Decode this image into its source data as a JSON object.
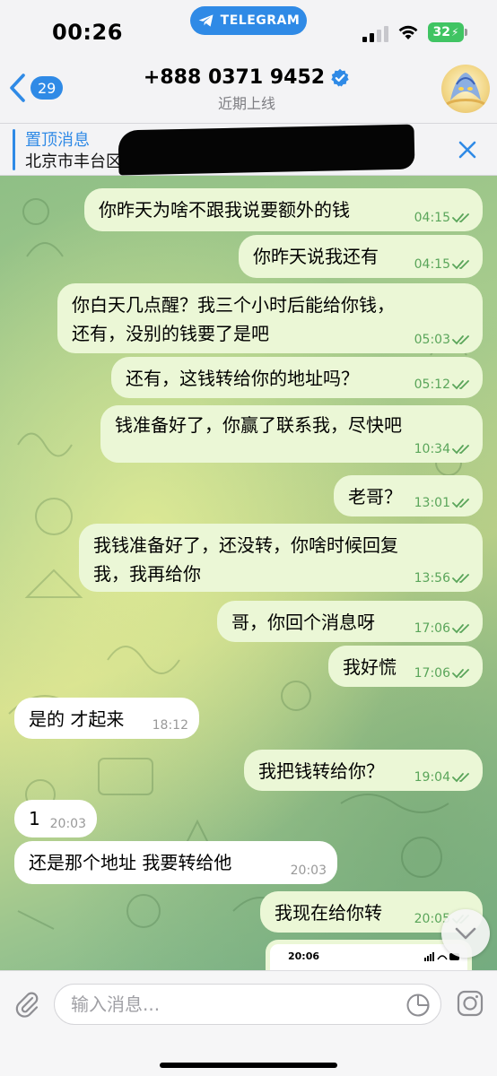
{
  "status_bar": {
    "time": "00:26",
    "app_pill": "TELEGRAM",
    "battery": "32"
  },
  "header": {
    "back_count": "29",
    "title": "+888 0371 9452",
    "subtitle": "近期上线"
  },
  "pinned": {
    "label": "置顶消息",
    "text": "北京市丰台区"
  },
  "messages": [
    {
      "dir": "out",
      "text": "你昨天为啥不跟我说要额外的钱",
      "time": "04:15"
    },
    {
      "dir": "out",
      "text": "你昨天说我还有",
      "time": "04:15"
    },
    {
      "dir": "out",
      "text": "你白天几点醒？我三个小时后能给你钱，\n还有，没别的钱要了是吧",
      "time": "05:03"
    },
    {
      "dir": "out",
      "text": "还有，这钱转给你的地址吗？",
      "time": "05:12"
    },
    {
      "dir": "out",
      "text": "钱准备好了，你赢了联系我，尽快吧",
      "time": "10:34"
    },
    {
      "dir": "out",
      "text": "老哥？",
      "time": "13:01"
    },
    {
      "dir": "out",
      "text": "我钱准备好了，还没转，你啥时候回复\n我，我再给你",
      "time": "13:56"
    },
    {
      "dir": "out",
      "text": "哥，你回个消息呀",
      "time": "17:06"
    },
    {
      "dir": "out",
      "text": "我好慌",
      "time": "17:06"
    },
    {
      "dir": "in",
      "text": "是的 才起来",
      "time": "18:12"
    },
    {
      "dir": "out",
      "text": "我把钱转给你？",
      "time": "19:04"
    },
    {
      "dir": "in",
      "text": "1",
      "time": "20:03"
    },
    {
      "dir": "in",
      "text": "还是那个地址 我要转给他",
      "time": "20:03"
    },
    {
      "dir": "out",
      "text": "我现在给你转",
      "time": "20:05"
    }
  ],
  "attachment": {
    "time": "20:06"
  },
  "composer": {
    "placeholder": "输入消息..."
  },
  "colors": {
    "accent": "#2f8ae6",
    "outgoing_bubble": "#ebf7d6",
    "incoming_bubble": "#ffffff",
    "read_ticks": "#5aa55a"
  }
}
